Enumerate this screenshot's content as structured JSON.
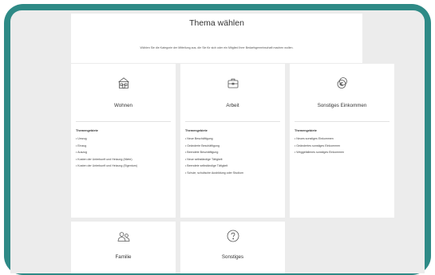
{
  "page": {
    "title": "Thema wählen",
    "subtitle": "Wählen Sie die Kategorie der Mitteilung aus, die Sie für sich oder ein Mitglied Ihrer Bedarfsgemeinschaft machen wollen."
  },
  "cards": [
    {
      "label": "Wohnen",
      "icon": "house-icon",
      "section": "Themengebiete",
      "items": [
        "Umzug",
        "Einzug",
        "Auszug",
        "Kosten der Unterkunft und Heizung (Miete)",
        "Kosten der Unterkunft und Heizung (Eigentum)"
      ]
    },
    {
      "label": "Arbeit",
      "icon": "briefcase-icon",
      "section": "Themengebiete",
      "items": [
        "Neue Beschäftigung",
        "Geänderte Beschäftigung",
        "Beendete Beschäftigung",
        "Neue selbständige Tätigkeit",
        "Beendete selbständige Tätigkeit",
        "Schule, schulische Ausbildung oder Studium"
      ]
    },
    {
      "label": "Sonstiges Einkommen",
      "icon": "euro-coins-icon",
      "section": "Themengebiete",
      "items": [
        "Neues sonstiges Einkommen",
        "Geändertes sonstiges Einkommen",
        "Weggefallenes sonstiges Einkommen"
      ]
    },
    {
      "label": "Familie",
      "icon": "family-icon"
    },
    {
      "label": "Sonstiges",
      "icon": "question-icon"
    }
  ],
  "colors": {
    "frame": "#2e8a86",
    "background": "#ececec",
    "card": "#ffffff",
    "icon": "#555555"
  }
}
